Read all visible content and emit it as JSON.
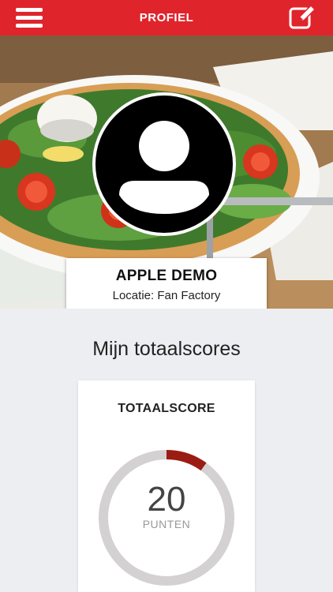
{
  "header": {
    "title": "PROFIEL",
    "menu_icon": "hamburger-menu-icon",
    "edit_icon": "edit-profile-icon",
    "color": "#e0242b"
  },
  "profile": {
    "name": "APPLE DEMO",
    "location": "Locatie: Fan Factory",
    "avatar_icon": "user-placeholder-icon",
    "cover_image": "pizza-salad-photo"
  },
  "scores": {
    "section_title": "Mijn totaalscores",
    "card_label": "TOTAALSCORE",
    "value": "20",
    "unit": "PUNTEN",
    "progress_fraction": 0.1,
    "progress_color": "#9b1c12",
    "track_color": "#d3d1d1"
  }
}
